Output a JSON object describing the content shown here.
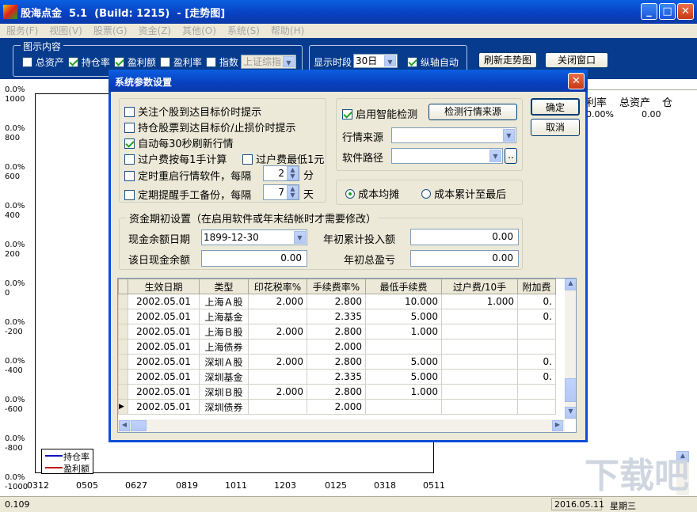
{
  "app": {
    "title": "股海点金  5.1  (Build: 1215)  - [走势图]"
  },
  "menu": [
    "服务(F)",
    "视图(V)",
    "股票(G)",
    "资金(Z)",
    "其他(O)",
    "系统(S)",
    "帮助(H)"
  ],
  "toolbar": {
    "group_title": "图示内容",
    "checks": [
      {
        "label": "总资产",
        "checked": false
      },
      {
        "label": "持仓率",
        "checked": true
      },
      {
        "label": "盈利额",
        "checked": true
      },
      {
        "label": "盈利率",
        "checked": false
      },
      {
        "label": "指数",
        "checked": false
      }
    ],
    "index_combo": "上证综指",
    "period_label": "显示时段",
    "period_value": "30日",
    "axis_auto_label": "纵轴自动",
    "refresh_label": "刷新走势图",
    "close_label": "关闭窗口"
  },
  "chart_data": {
    "type": "line",
    "title": "",
    "y_left": [
      "0.0%",
      "0.0%",
      "0.0%",
      "0.0%",
      "0.0%",
      "0.0%",
      "0.0%",
      "0.0%",
      "0.0%",
      "0.0%",
      "0.0%"
    ],
    "y_right": [
      "1000",
      "800",
      "600",
      "400",
      "200",
      "0",
      "-200",
      "-400",
      "-600",
      "-800",
      "-1000"
    ],
    "x_ticks": [
      "0312",
      "0505",
      "0627",
      "0819",
      "1011",
      "1203",
      "0125",
      "0318",
      "0511"
    ],
    "legend": [
      {
        "name": "持仓率",
        "color": "#1010c0"
      },
      {
        "name": "盈利额",
        "color": "#c01010"
      }
    ]
  },
  "right_table": {
    "headers": [
      "利率",
      "总资产",
      "仓"
    ],
    "row": [
      "0.00%",
      "0.00",
      ""
    ]
  },
  "status": {
    "left": "0.109",
    "date": "2016.05.11",
    "weekday": "星期三"
  },
  "watermark": "下载吧",
  "dialog": {
    "title": "系统参数设置",
    "ok": "确定",
    "cancel": "取消",
    "opts": [
      {
        "label": "关注个股到达目标价时提示",
        "checked": false
      },
      {
        "label": "持仓股票到达目标价/止损价时提示",
        "checked": false
      },
      {
        "label": "自动每30秒刷新行情",
        "checked": true
      }
    ],
    "transfer_label": "过户费按每1手计算",
    "transfer_checked": false,
    "transfer_min_label": "过户费最低1元",
    "transfer_min_checked": false,
    "restart_label": "定时重启行情软件，每隔",
    "restart_checked": false,
    "restart_value": "2",
    "restart_unit": "分",
    "backup_label": "定期提醒手工备份，每隔",
    "backup_checked": false,
    "backup_value": "7",
    "backup_unit": "天",
    "smart_label": "启用智能检测",
    "smart_checked": true,
    "detect_btn": "检测行情来源",
    "source_label": "行情来源",
    "source_value": "",
    "path_label": "软件路径",
    "path_value": "",
    "browse": "..",
    "cost_avg": "成本均摊",
    "cost_last": "成本累计至最后",
    "fund_title": "资金期初设置（在启用软件或年末结帐时才需要修改）",
    "cash_date_label": "现金余额日期",
    "cash_date_value": "1899-12-30",
    "year_invest_label": "年初累计投入额",
    "year_invest_value": "0.00",
    "day_cash_label": "该日现金余额",
    "day_cash_value": "0.00",
    "year_pl_label": "年初总盈亏",
    "year_pl_value": "0.00",
    "fee_headers": [
      "生效日期",
      "类型",
      "印花税率%",
      "手续费率%",
      "最低手续费",
      "过户费/10手",
      "附加费"
    ],
    "fee_rows": [
      [
        "2002.05.01",
        "上海Ａ股",
        "2.000",
        "2.800",
        "10.000",
        "1.000",
        "0."
      ],
      [
        "2002.05.01",
        "上海基金",
        "",
        "2.335",
        "5.000",
        "",
        "0."
      ],
      [
        "2002.05.01",
        "上海Ｂ股",
        "2.000",
        "2.800",
        "1.000",
        "",
        ""
      ],
      [
        "2002.05.01",
        "上海债券",
        "",
        "2.000",
        "",
        "",
        ""
      ],
      [
        "2002.05.01",
        "深圳Ａ股",
        "2.000",
        "2.800",
        "5.000",
        "",
        "0."
      ],
      [
        "2002.05.01",
        "深圳基金",
        "",
        "2.335",
        "5.000",
        "",
        "0."
      ],
      [
        "2002.05.01",
        "深圳Ｂ股",
        "2.000",
        "2.800",
        "1.000",
        "",
        ""
      ],
      [
        "2002.05.01",
        "深圳债券",
        "",
        "2.000",
        "",
        "",
        ""
      ]
    ]
  }
}
